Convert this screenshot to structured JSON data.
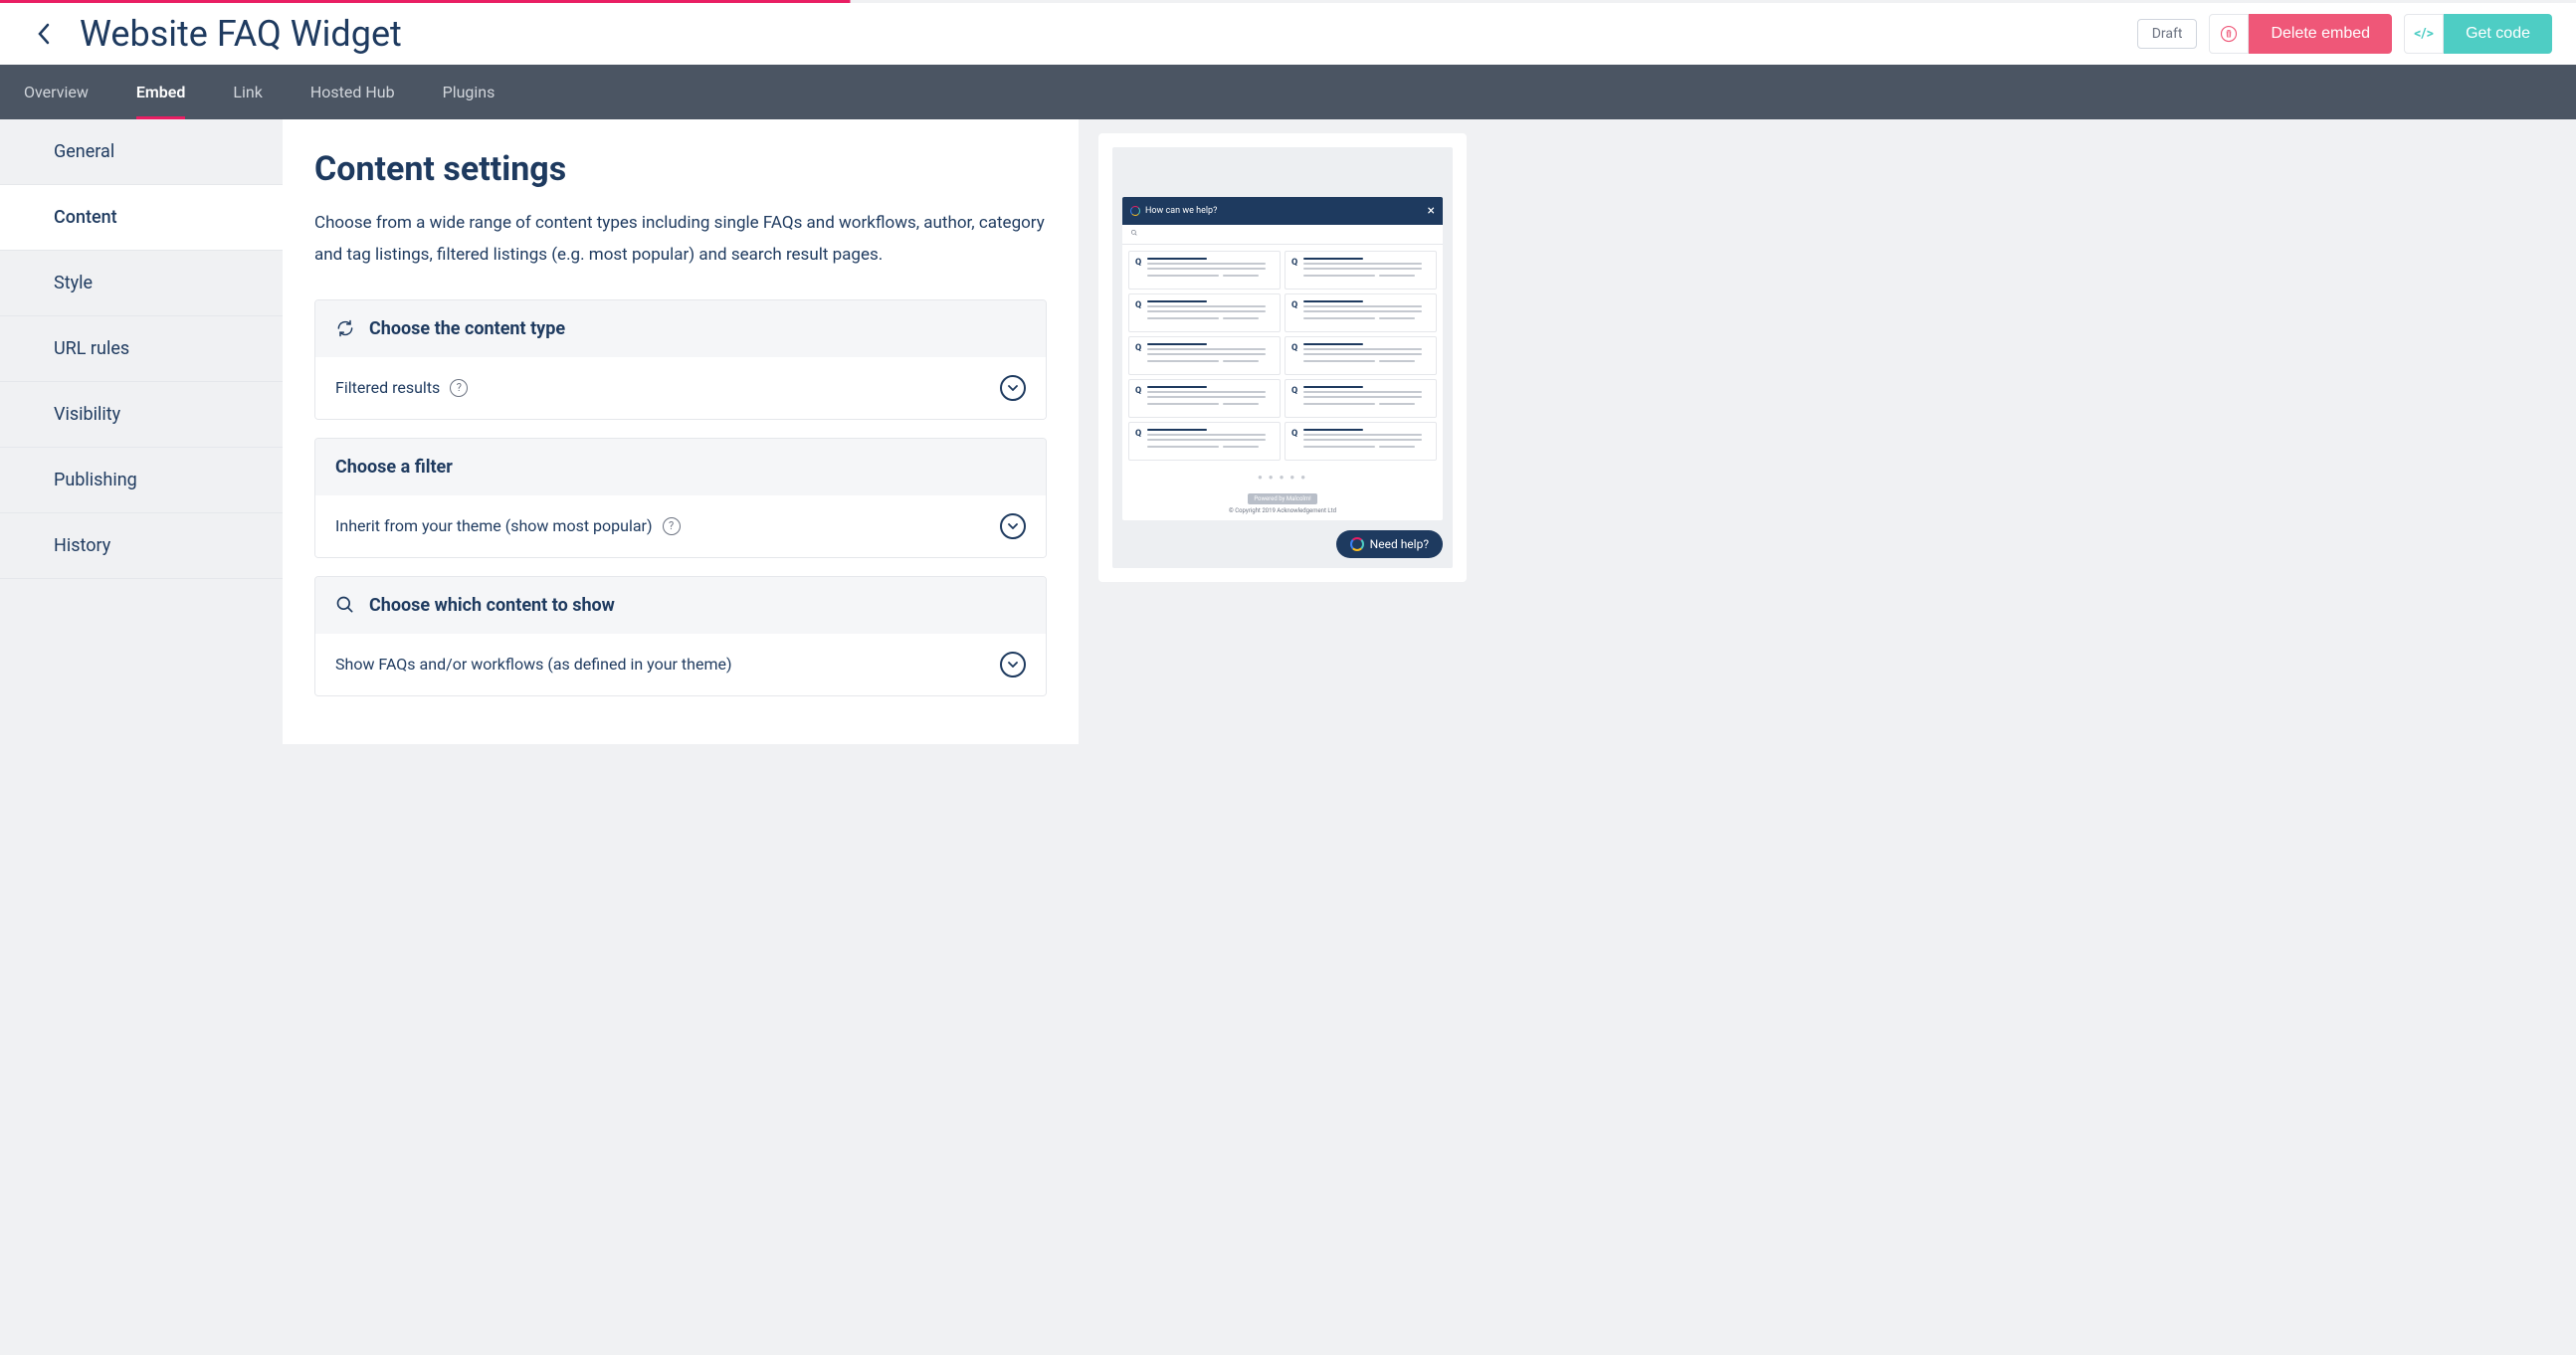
{
  "header": {
    "title": "Website FAQ Widget",
    "draft_label": "Draft",
    "delete_label": "Delete embed",
    "getcode_label": "Get code"
  },
  "nav": {
    "items": [
      "Overview",
      "Embed",
      "Link",
      "Hosted Hub",
      "Plugins"
    ],
    "active_index": 1
  },
  "sidebar": {
    "items": [
      "General",
      "Content",
      "Style",
      "URL rules",
      "Visibility",
      "Publishing",
      "History"
    ],
    "active_index": 1
  },
  "main": {
    "heading": "Content settings",
    "description": "Choose from a wide range of content types including single FAQs and workflows, author, category and tag listings, filtered listings (e.g. most popular) and search result pages.",
    "panels": [
      {
        "title": "Choose the content type",
        "value": "Filtered results",
        "has_help": true,
        "icon": "refresh"
      },
      {
        "title": "Choose a filter",
        "value": "Inherit from your theme (show most popular)",
        "has_help": true,
        "icon": null
      },
      {
        "title": "Choose which content to show",
        "value": "Show FAQs and/or workflows (as defined in your theme)",
        "has_help": false,
        "icon": "search"
      }
    ]
  },
  "preview": {
    "widget_title": "How can we help?",
    "powered_by": "Powered by Malcolm!",
    "copyright": "© Copyright 2019 Acknowledgement Ltd",
    "need_help": "Need help?"
  }
}
